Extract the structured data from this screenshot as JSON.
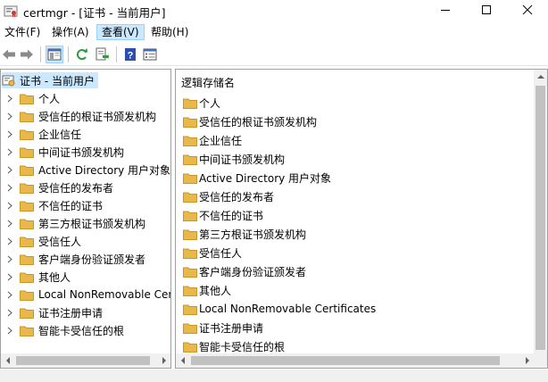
{
  "window": {
    "title": "certmgr - [证书 - 当前用户]"
  },
  "menu": {
    "items": [
      {
        "label": "文件(F)"
      },
      {
        "label": "操作(A)"
      },
      {
        "label": "查看(V)"
      },
      {
        "label": "帮助(H)"
      }
    ]
  },
  "toolbar": {
    "icons": [
      "back-arrow-icon",
      "forward-arrow-icon",
      "show-console-tree-icon",
      "refresh-icon",
      "export-list-icon",
      "help-icon",
      "properties-icon"
    ]
  },
  "tree": {
    "root": "证书 - 当前用户",
    "items": [
      {
        "label": "个人"
      },
      {
        "label": "受信任的根证书颁发机构"
      },
      {
        "label": "企业信任"
      },
      {
        "label": "中间证书颁发机构"
      },
      {
        "label": "Active Directory 用户对象"
      },
      {
        "label": "受信任的发布者"
      },
      {
        "label": "不信任的证书"
      },
      {
        "label": "第三方根证书颁发机构"
      },
      {
        "label": "受信任人"
      },
      {
        "label": "客户端身份验证颁发者"
      },
      {
        "label": "其他人"
      },
      {
        "label": "Local NonRemovable Cert"
      },
      {
        "label": "证书注册申请"
      },
      {
        "label": "智能卡受信任的根"
      }
    ]
  },
  "list": {
    "header": "逻辑存储名",
    "items": [
      {
        "label": "个人"
      },
      {
        "label": "受信任的根证书颁发机构"
      },
      {
        "label": "企业信任"
      },
      {
        "label": "中间证书颁发机构"
      },
      {
        "label": "Active Directory 用户对象"
      },
      {
        "label": "受信任的发布者"
      },
      {
        "label": "不信任的证书"
      },
      {
        "label": "第三方根证书颁发机构"
      },
      {
        "label": "受信任人"
      },
      {
        "label": "客户端身份验证颁发者"
      },
      {
        "label": "其他人"
      },
      {
        "label": "Local NonRemovable Certificates"
      },
      {
        "label": "证书注册申请"
      },
      {
        "label": "智能卡受信任的根"
      }
    ]
  },
  "colors": {
    "selection": "#cce8ff",
    "folder": "#e8b84a"
  }
}
